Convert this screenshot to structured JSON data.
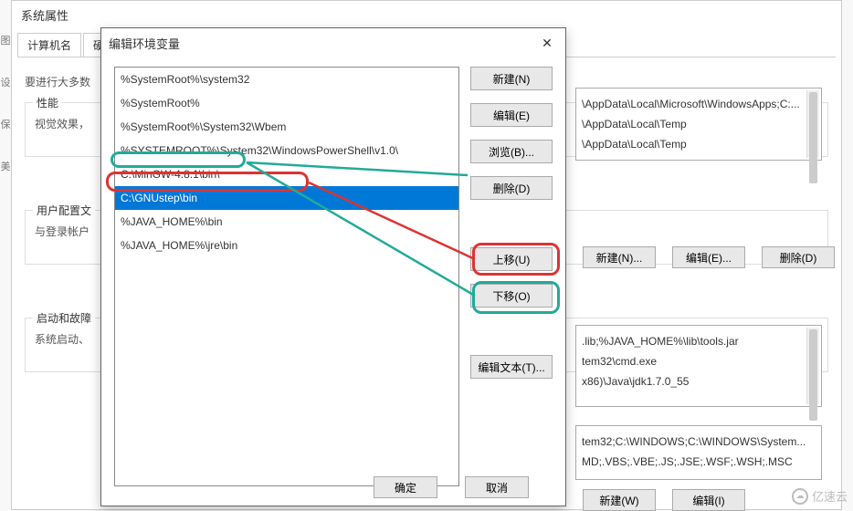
{
  "bg": {
    "title": "系统属性",
    "tabs": [
      "计算机名",
      "硬件"
    ],
    "body_prefix": "要进行大多数",
    "group_perf": {
      "label": "性能",
      "line": "视觉效果，"
    },
    "group_user": {
      "label": "用户配置文",
      "line": "与登录帐户"
    },
    "group_boot": {
      "label": "启动和故障",
      "line": "系统启动、"
    }
  },
  "right": {
    "list1": [
      "\\AppData\\Local\\Microsoft\\WindowsApps;C:...",
      "\\AppData\\Local\\Temp",
      "\\AppData\\Local\\Temp"
    ],
    "btns1": [
      "新建(N)...",
      "编辑(E)...",
      "删除(D)"
    ],
    "list2": [
      ".lib;%JAVA_HOME%\\lib\\tools.jar",
      "tem32\\cmd.exe",
      "x86)\\Java\\jdk1.7.0_55"
    ],
    "list3": [
      "tem32;C:\\WINDOWS;C:\\WINDOWS\\System...",
      "MD;.VBS;.VBE;.JS;.JSE;.WSF;.WSH;.MSC"
    ],
    "btns2": [
      "新建(W)",
      "编辑(I)"
    ]
  },
  "dialog": {
    "title": "编辑环境变量",
    "close_icon": "✕",
    "rows": [
      "%SystemRoot%\\system32",
      "%SystemRoot%",
      "%SystemRoot%\\System32\\Wbem",
      "%SYSTEMROOT%\\System32\\WindowsPowerShell\\v1.0\\",
      "C:\\MinGW-4.8.1\\bin\\",
      "C:\\GNUstep\\bin",
      "%JAVA_HOME%\\bin",
      "%JAVA_HOME%\\jre\\bin"
    ],
    "selected_index": 5,
    "buttons": {
      "new": "新建(N)",
      "edit": "编辑(E)",
      "browse": "浏览(B)...",
      "delete": "删除(D)",
      "up": "上移(U)",
      "down": "下移(O)",
      "edit_text": "编辑文本(T)..."
    },
    "ok": "确定",
    "cancel": "取消"
  },
  "watermark": "亿速云"
}
